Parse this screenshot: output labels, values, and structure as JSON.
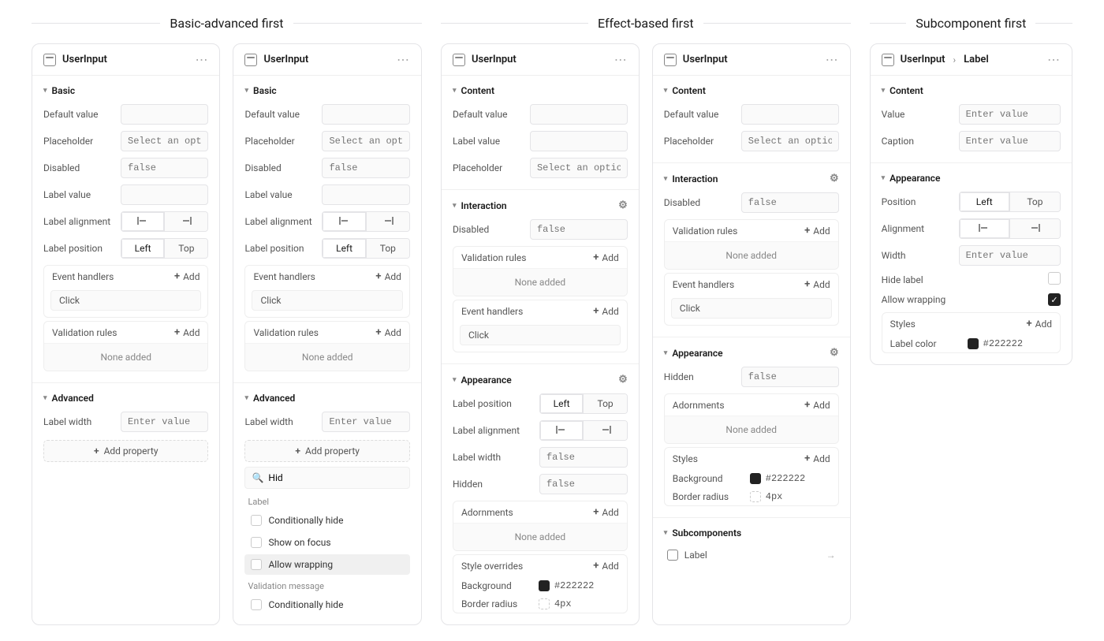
{
  "groups": [
    "Basic-advanced first",
    "Effect-based first",
    "Subcomponent first"
  ],
  "component": "UserInput",
  "label_crumb": "Label",
  "sections": {
    "basic": "Basic",
    "advanced": "Advanced",
    "content": "Content",
    "interaction": "Interaction",
    "appearance": "Appearance",
    "subcomponents": "Subcomponents"
  },
  "labels": {
    "default_value": "Default value",
    "placeholder": "Placeholder",
    "disabled": "Disabled",
    "label_value": "Label value",
    "label_alignment": "Label alignment",
    "label_position": "Label position",
    "event_handlers": "Event handlers",
    "click": "Click",
    "validation_rules": "Validation rules",
    "none_added": "None added",
    "label_width": "Label width",
    "add_property": "Add property",
    "hidden": "Hidden",
    "adornments": "Adornments",
    "style_overrides": "Style overrides",
    "styles": "Styles",
    "background": "Background",
    "border_radius": "Border radius",
    "value": "Value",
    "caption": "Caption",
    "position": "Position",
    "alignment": "Alignment",
    "width": "Width",
    "hide_label": "Hide label",
    "allow_wrapping": "Allow wrapping",
    "label_color": "Label color",
    "add": "Add",
    "left": "Left",
    "top": "Top",
    "label_group": "Label",
    "validation_message": "Validation message"
  },
  "placeholders": {
    "select_option": "Select an option",
    "enter_value": "Enter value",
    "false": "false"
  },
  "values": {
    "color_hex": "#222222",
    "radius": "4px",
    "search": "Hid"
  },
  "options": {
    "cond_hide": "Conditionally hide",
    "show_focus": "Show on focus",
    "allow_wrap": "Allow wrapping"
  }
}
